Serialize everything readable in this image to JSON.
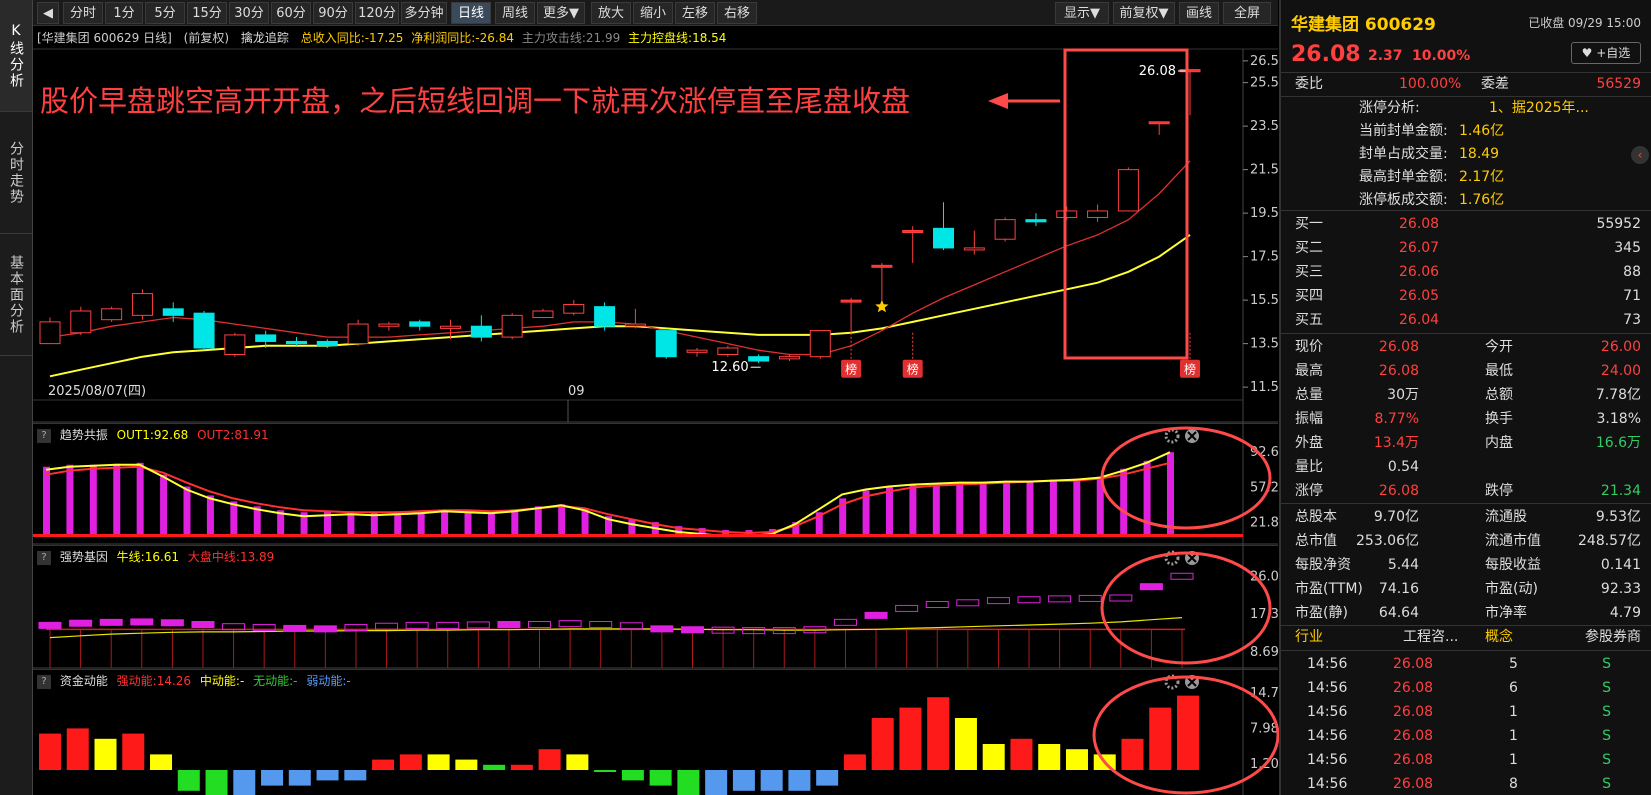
{
  "sidebar": {
    "tabs": [
      "K线分析",
      "分时走势",
      "基本面分析"
    ]
  },
  "toolbar": {
    "collapse_icon": "◀",
    "periods": [
      "分时",
      "1分",
      "5分",
      "15分",
      "30分",
      "60分",
      "90分",
      "120分",
      "多分钟",
      "日线",
      "周线",
      "更多▼"
    ],
    "actions": [
      "放大",
      "缩小",
      "左移",
      "右移"
    ],
    "right": [
      "显示▼",
      "前复权▼",
      "画线",
      "全屏"
    ]
  },
  "header": {
    "name": "[华建集团 600629 日线]",
    "adj": "(前复权)",
    "indicator": "擒龙追踪",
    "rev": "总收入同比:-17.25",
    "profit": "净利润同比:-26.84",
    "attack": "主力攻击线:21.99",
    "control": "主力控盘线:18.54"
  },
  "annotation": "股价早盘跳空高开开盘，之后短线回调一下就再次涨停直至尾盘收盘",
  "main_chart": {
    "price_ticks": [
      "26.50",
      "25.50",
      "23.50",
      "21.50",
      "19.50",
      "17.50",
      "15.50",
      "13.50",
      "11.50"
    ],
    "date_label": "2025/08/07(四)",
    "month_label": "09",
    "low_label": "12.60",
    "high_label": "26.08",
    "badge": "榜"
  },
  "panel1": {
    "name": "趋势共振",
    "out1": "OUT1:92.68",
    "out2": "OUT2:81.91",
    "ticks": [
      "92.68",
      "57.26",
      "21.84"
    ]
  },
  "panel2": {
    "name": "强势基因",
    "bull": "牛线:16.61",
    "mid": "大盘中线:13.89",
    "ticks": [
      "26.08",
      "17.39",
      "8.69"
    ]
  },
  "panel3": {
    "name": "资金动能",
    "strong": "强动能:14.26",
    "medium": "中动能:-",
    "none": "无动能:-",
    "weak": "弱动能:-",
    "ticks": [
      "14.76",
      "7.98",
      "1.20"
    ]
  },
  "chart_data": {
    "type": "candlestick",
    "ohlc": [
      [
        13.5,
        14.5,
        13.5,
        14.7
      ],
      [
        14.0,
        15.0,
        13.9,
        15.2
      ],
      [
        14.6,
        15.1,
        14.5,
        15.2
      ],
      [
        14.8,
        15.8,
        14.6,
        16.0
      ],
      [
        15.1,
        14.8,
        14.5,
        15.4
      ],
      [
        14.9,
        13.3,
        13.2,
        15.0
      ],
      [
        13.0,
        13.9,
        12.9,
        14.0
      ],
      [
        13.9,
        13.6,
        13.3,
        14.1
      ],
      [
        13.6,
        13.5,
        13.4,
        13.8
      ],
      [
        13.6,
        13.4,
        13.3,
        13.7
      ],
      [
        13.5,
        14.4,
        13.4,
        14.6
      ],
      [
        14.3,
        14.4,
        14.1,
        14.5
      ],
      [
        14.5,
        14.3,
        14.1,
        14.6
      ],
      [
        14.2,
        14.3,
        13.7,
        14.6
      ],
      [
        14.3,
        13.8,
        13.6,
        14.8
      ],
      [
        13.8,
        14.8,
        13.7,
        14.9
      ],
      [
        14.7,
        15.0,
        14.7,
        15.1
      ],
      [
        14.9,
        15.3,
        14.8,
        15.5
      ],
      [
        15.2,
        14.3,
        14.1,
        15.4
      ],
      [
        14.4,
        14.4,
        14.2,
        15.1
      ],
      [
        14.1,
        12.9,
        12.8,
        14.1
      ],
      [
        13.1,
        13.2,
        12.9,
        13.3
      ],
      [
        13.0,
        13.3,
        12.9,
        13.4
      ],
      [
        12.9,
        12.7,
        12.6,
        13.0
      ],
      [
        12.8,
        12.9,
        12.7,
        13.0
      ],
      [
        12.9,
        14.1,
        12.8,
        14.1
      ],
      [
        15.5,
        15.5,
        14.0,
        15.6
      ],
      [
        17.1,
        17.1,
        15.5,
        17.2
      ],
      [
        18.7,
        18.7,
        17.2,
        18.9
      ],
      [
        18.8,
        17.9,
        17.8,
        20.0
      ],
      [
        17.9,
        17.9,
        17.6,
        18.7
      ],
      [
        18.3,
        19.2,
        18.2,
        19.3
      ],
      [
        19.2,
        19.1,
        18.9,
        19.5
      ],
      [
        19.3,
        19.6,
        19.2,
        19.8
      ],
      [
        19.3,
        19.6,
        19.1,
        19.9
      ],
      [
        19.6,
        21.5,
        19.6,
        21.6
      ],
      [
        23.7,
        23.7,
        23.1,
        23.7
      ],
      [
        26.0,
        26.1,
        24.0,
        26.1
      ]
    ],
    "ma_red": [
      13.8,
      14.0,
      14.3,
      14.5,
      14.7,
      14.6,
      14.4,
      14.2,
      14.0,
      13.8,
      13.8,
      13.8,
      13.9,
      14.0,
      14.1,
      14.2,
      14.3,
      14.5,
      14.5,
      14.4,
      14.1,
      13.8,
      13.5,
      13.2,
      13.0,
      13.0,
      13.4,
      14.1,
      14.9,
      15.6,
      16.2,
      16.8,
      17.4,
      18.0,
      18.5,
      19.2,
      20.4,
      21.9
    ],
    "ma_yellow": [
      12.0,
      12.3,
      12.6,
      12.9,
      13.1,
      13.2,
      13.3,
      13.4,
      13.4,
      13.4,
      13.5,
      13.6,
      13.7,
      13.8,
      13.9,
      14.0,
      14.1,
      14.2,
      14.3,
      14.3,
      14.2,
      14.1,
      14.0,
      13.9,
      13.9,
      13.9,
      14.0,
      14.2,
      14.5,
      14.8,
      15.1,
      15.4,
      15.7,
      16.0,
      16.3,
      16.8,
      17.5,
      18.5
    ],
    "p1_bars": [
      78,
      80,
      80,
      81,
      82,
      70,
      58,
      49,
      43,
      38,
      34,
      32,
      33,
      33,
      32,
      33,
      34,
      34,
      33,
      33,
      35,
      38,
      40,
      36,
      28,
      25,
      22,
      18,
      16,
      14,
      14,
      15,
      22,
      32,
      46,
      54,
      58,
      60,
      61,
      62,
      62,
      63,
      64,
      65,
      66,
      68,
      76,
      84,
      92.7
    ],
    "p1_yellow": [
      75,
      78,
      79,
      80,
      80,
      68,
      55,
      46,
      40,
      35,
      31,
      28,
      29,
      30,
      29,
      30,
      31,
      33,
      32,
      31,
      33,
      36,
      39,
      34,
      25,
      20,
      16,
      12,
      10,
      8,
      8,
      10,
      20,
      35,
      50,
      55,
      58,
      60,
      61,
      62,
      62,
      63,
      63,
      64,
      65,
      67,
      74,
      82,
      92.7
    ],
    "p1_red": [
      70,
      74,
      76,
      77,
      78,
      72,
      62,
      53,
      46,
      41,
      37,
      34,
      33,
      32,
      32,
      32,
      33,
      34,
      34,
      33,
      34,
      36,
      38,
      36,
      30,
      25,
      20,
      16,
      14,
      12,
      11,
      12,
      18,
      28,
      40,
      48,
      53,
      57,
      59,
      60,
      61,
      62,
      63,
      64,
      64,
      66,
      70,
      76,
      82
    ],
    "p2_boxes": [
      14.8,
      15.3,
      15.5,
      15.6,
      15.4,
      15.0,
      14.5,
      14.3,
      14.1,
      14.0,
      14.3,
      14.6,
      14.8,
      14.8,
      14.9,
      15.0,
      15.0,
      15.2,
      15.0,
      14.7,
      14.0,
      13.8,
      13.7,
      13.6,
      13.6,
      13.8,
      15.5,
      17.1,
      18.7,
      19.6,
      20.0,
      20.5,
      20.7,
      20.9,
      21.0,
      21.1,
      23.7,
      26.1
    ],
    "p2_yellow": [
      12.0,
      12.4,
      12.8,
      13.0,
      13.2,
      13.3,
      13.3,
      13.4,
      13.5,
      13.5,
      13.6,
      13.6,
      13.7,
      13.7,
      13.8,
      13.8,
      13.9,
      14.0,
      14.0,
      14.0,
      14.0,
      13.9,
      13.8,
      13.8,
      13.7,
      13.7,
      13.8,
      13.9,
      14.1,
      14.3,
      14.5,
      14.7,
      14.9,
      15.1,
      15.3,
      15.6,
      16.1,
      16.6
    ],
    "p3_bars": [
      [
        7,
        "r"
      ],
      [
        8,
        "r"
      ],
      [
        6,
        "y"
      ],
      [
        7,
        "r"
      ],
      [
        3,
        "y"
      ],
      [
        -4,
        "g"
      ],
      [
        -7,
        "g"
      ],
      [
        -5,
        "b"
      ],
      [
        -3,
        "b"
      ],
      [
        -3,
        "b"
      ],
      [
        -2,
        "b"
      ],
      [
        -2,
        "b"
      ],
      [
        2,
        "r"
      ],
      [
        3,
        "r"
      ],
      [
        3,
        "y"
      ],
      [
        2,
        "y"
      ],
      [
        1,
        "g"
      ],
      [
        1,
        "r"
      ],
      [
        4,
        "r"
      ],
      [
        3,
        "y"
      ],
      [
        0,
        "g"
      ],
      [
        -2,
        "g"
      ],
      [
        -3,
        "g"
      ],
      [
        -7,
        "g"
      ],
      [
        -6,
        "b"
      ],
      [
        -4,
        "b"
      ],
      [
        -4,
        "b"
      ],
      [
        -4,
        "b"
      ],
      [
        -3,
        "b"
      ],
      [
        3,
        "r"
      ],
      [
        10,
        "r"
      ],
      [
        12,
        "r"
      ],
      [
        14,
        "r"
      ],
      [
        10,
        "y"
      ],
      [
        5,
        "y"
      ],
      [
        6,
        "r"
      ],
      [
        5,
        "y"
      ],
      [
        4,
        "y"
      ],
      [
        3,
        "y"
      ],
      [
        6,
        "r"
      ],
      [
        12,
        "r"
      ],
      [
        14.3,
        "r"
      ]
    ]
  },
  "quote": {
    "name": "华建集团 600629",
    "status": "已收盘 09/29 15:00",
    "price": "26.08",
    "change": "2.37",
    "pct": "10.00%",
    "fav": "♥ +自选",
    "weibi_l": "委比",
    "weibi_v": "100.00%",
    "weicha_l": "委差",
    "weicha_v": "56529",
    "limit_rows": [
      {
        "l": "涨停分析:",
        "v": "1、据2025年..."
      },
      {
        "l": "当前封单金额:",
        "v": "1.46亿"
      },
      {
        "l": "封单占成交量:",
        "v": "18.49"
      },
      {
        "l": "最高封单金额:",
        "v": "2.17亿"
      },
      {
        "l": "涨停板成交额:",
        "v": "1.76亿"
      }
    ],
    "bids": [
      {
        "l": "买一",
        "p": "26.08",
        "v": "55952"
      },
      {
        "l": "买二",
        "p": "26.07",
        "v": "345"
      },
      {
        "l": "买三",
        "p": "26.06",
        "v": "88"
      },
      {
        "l": "买四",
        "p": "26.05",
        "v": "71"
      },
      {
        "l": "买五",
        "p": "26.04",
        "v": "73"
      }
    ],
    "stats": [
      {
        "l1": "现价",
        "v1": "26.08",
        "c1": "red",
        "l2": "今开",
        "v2": "26.00",
        "c2": "red"
      },
      {
        "l1": "最高",
        "v1": "26.08",
        "c1": "red",
        "l2": "最低",
        "v2": "24.00",
        "c2": "red"
      },
      {
        "l1": "总量",
        "v1": "30万",
        "c1": "white",
        "l2": "总额",
        "v2": "7.78亿",
        "c2": "white"
      },
      {
        "l1": "振幅",
        "v1": "8.77%",
        "c1": "red",
        "l2": "换手",
        "v2": "3.18%",
        "c2": "white"
      },
      {
        "l1": "外盘",
        "v1": "13.4万",
        "c1": "red",
        "l2": "内盘",
        "v2": "16.6万",
        "c2": "green"
      },
      {
        "l1": "量比",
        "v1": "0.54",
        "c1": "white",
        "l2": "",
        "v2": "",
        "c2": "white"
      },
      {
        "l1": "涨停",
        "v1": "26.08",
        "c1": "red",
        "l2": "跌停",
        "v2": "21.34",
        "c2": "green"
      }
    ],
    "fund": [
      {
        "l1": "总股本",
        "v1": "9.70亿",
        "l2": "流通股",
        "v2": "9.53亿"
      },
      {
        "l1": "总市值",
        "v1": "253.06亿",
        "l2": "流通市值",
        "v2": "248.57亿"
      },
      {
        "l1": "每股净资",
        "v1": "5.44",
        "l2": "每股收益",
        "v2": "0.141"
      },
      {
        "l1": "市盈(TTM)",
        "v1": "74.16",
        "l2": "市盈(动)",
        "v2": "92.33"
      },
      {
        "l1": "市盈(静)",
        "v1": "64.64",
        "l2": "市净率",
        "v2": "4.79"
      }
    ],
    "industry": {
      "l1": "行业",
      "v1": "工程咨...",
      "l2": "概念",
      "v2": "参股券商"
    },
    "ticks": [
      {
        "t": "14:56",
        "p": "26.08",
        "v": "5",
        "s": "S"
      },
      {
        "t": "14:56",
        "p": "26.08",
        "v": "6",
        "s": "S"
      },
      {
        "t": "14:56",
        "p": "26.08",
        "v": "1",
        "s": "S"
      },
      {
        "t": "14:56",
        "p": "26.08",
        "v": "1",
        "s": "S"
      },
      {
        "t": "14:56",
        "p": "26.08",
        "v": "1",
        "s": "S"
      },
      {
        "t": "14:56",
        "p": "26.08",
        "v": "8",
        "s": "S"
      }
    ]
  }
}
